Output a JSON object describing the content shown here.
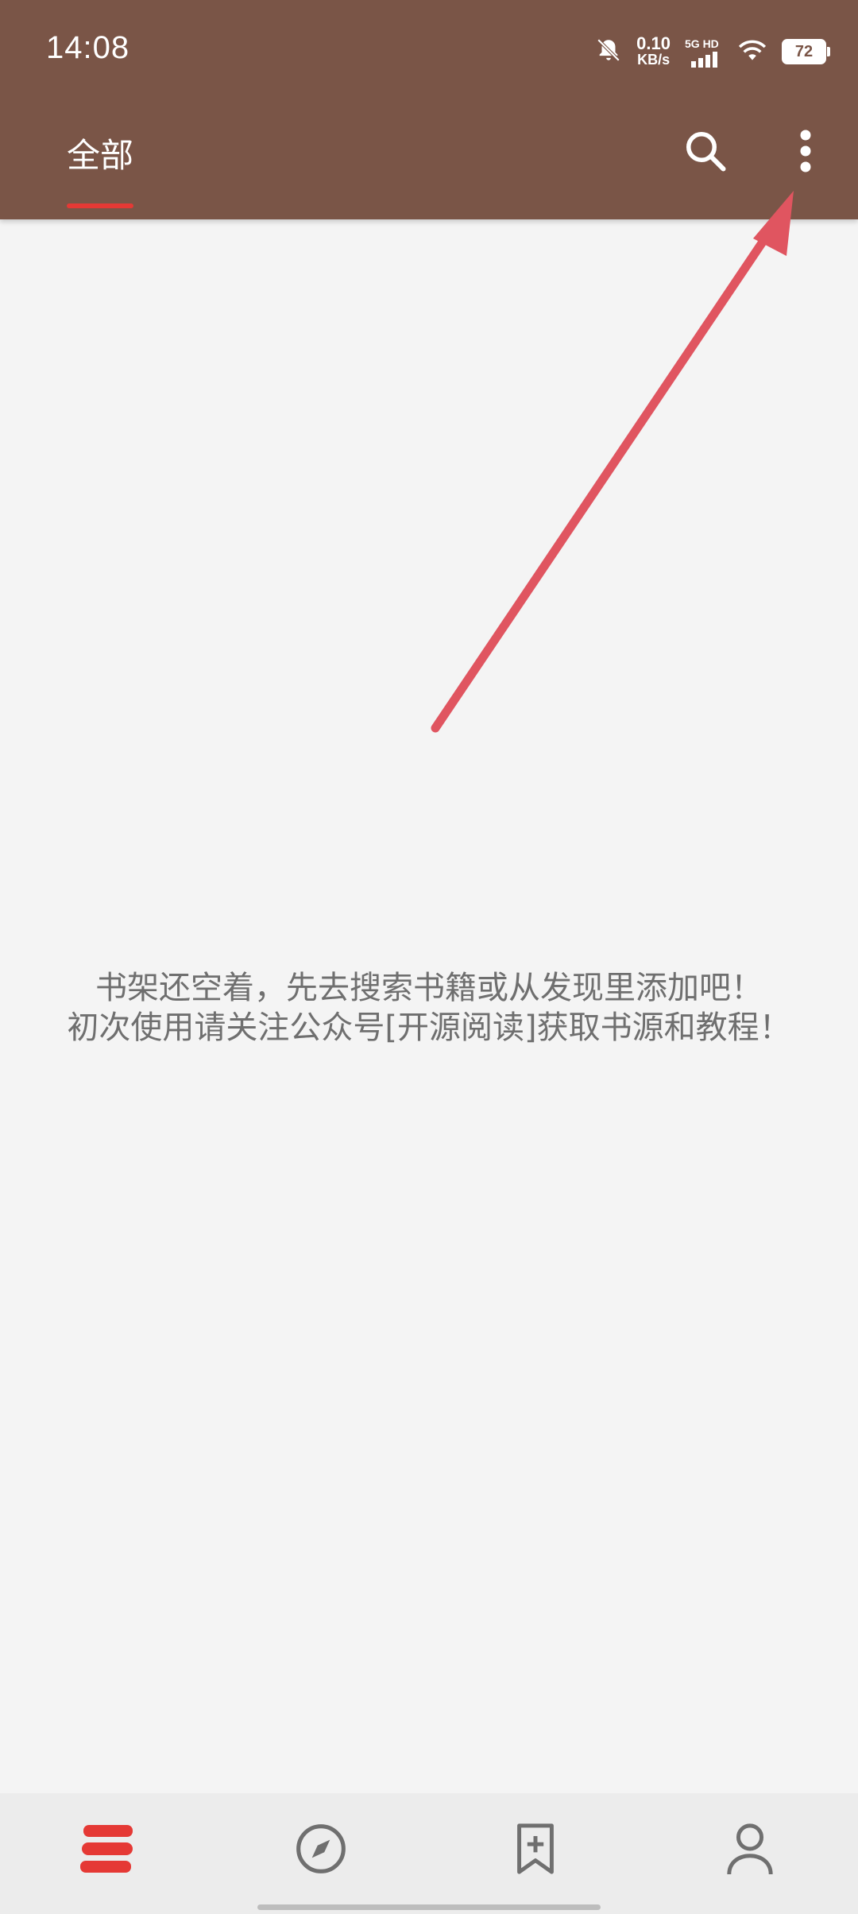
{
  "status_bar": {
    "time": "14:08",
    "net_speed_value": "0.10",
    "net_speed_unit": "KB/s",
    "network_label": "5G HD",
    "battery": "72",
    "icons": [
      "bell-muted-icon",
      "signal-icon",
      "wifi-icon",
      "battery-icon"
    ]
  },
  "app_bar": {
    "tab_label": "全部",
    "actions": [
      "search-icon",
      "more-vertical-icon"
    ]
  },
  "empty_state": {
    "line1": "书架还空着，先去搜索书籍或从发现里添加吧！",
    "line2": "初次使用请关注公众号[开源阅读]获取书源和教程！"
  },
  "bottom_nav": {
    "items": [
      {
        "icon": "bookshelf-icon",
        "active": true
      },
      {
        "icon": "compass-icon",
        "active": false
      },
      {
        "icon": "bookmark-add-icon",
        "active": false
      },
      {
        "icon": "person-icon",
        "active": false
      }
    ]
  },
  "colors": {
    "app_bar": "#7a5547",
    "accent": "#e53935",
    "annotation_arrow": "#e05560",
    "background": "#f4f4f4"
  }
}
